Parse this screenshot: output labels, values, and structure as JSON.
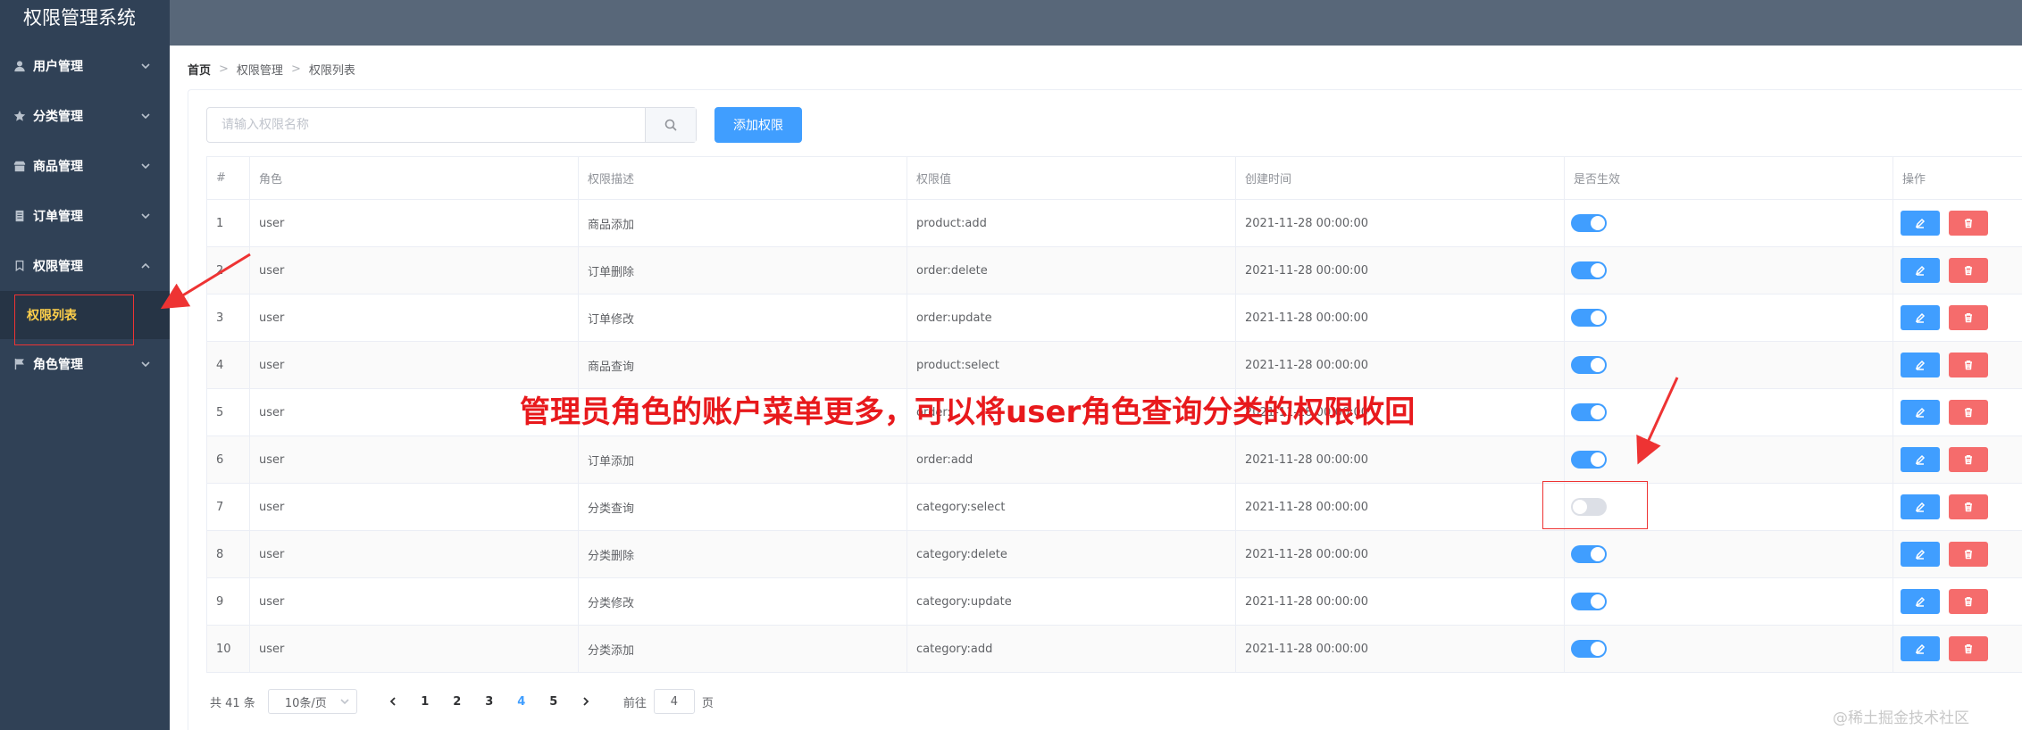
{
  "app": {
    "title": "权限管理系统"
  },
  "sidebar": {
    "items": [
      {
        "label": "用户管理",
        "icon": "user-icon"
      },
      {
        "label": "分类管理",
        "icon": "star-icon"
      },
      {
        "label": "商品管理",
        "icon": "shop-icon"
      },
      {
        "label": "订单管理",
        "icon": "order-icon"
      },
      {
        "label": "权限管理",
        "icon": "bookmark-icon",
        "expanded": true,
        "children": [
          {
            "label": "权限列表",
            "active": true
          }
        ]
      },
      {
        "label": "角色管理",
        "icon": "flag-icon"
      }
    ]
  },
  "breadcrumb": [
    "首页",
    "权限管理",
    "权限列表"
  ],
  "toolbar": {
    "search_placeholder": "请输入权限名称",
    "search_value": "",
    "add_label": "添加权限"
  },
  "table": {
    "columns": [
      "#",
      "角色",
      "权限描述",
      "权限值",
      "创建时间",
      "是否生效",
      "操作"
    ],
    "rows": [
      {
        "index": "1",
        "role": "user",
        "desc": "商品添加",
        "value": "product:add",
        "created": "2021-11-28 00:00:00",
        "enabled": true
      },
      {
        "index": "2",
        "role": "user",
        "desc": "订单删除",
        "value": "order:delete",
        "created": "2021-11-28 00:00:00",
        "enabled": true
      },
      {
        "index": "3",
        "role": "user",
        "desc": "订单修改",
        "value": "order:update",
        "created": "2021-11-28 00:00:00",
        "enabled": true
      },
      {
        "index": "4",
        "role": "user",
        "desc": "商品查询",
        "value": "product:select",
        "created": "2021-11-28 00:00:00",
        "enabled": true
      },
      {
        "index": "5",
        "role": "user",
        "desc": "",
        "value": "order:",
        "created": "2021-11-28 00:00:00",
        "enabled": true
      },
      {
        "index": "6",
        "role": "user",
        "desc": "订单添加",
        "value": "order:add",
        "created": "2021-11-28 00:00:00",
        "enabled": true
      },
      {
        "index": "7",
        "role": "user",
        "desc": "分类查询",
        "value": "category:select",
        "created": "2021-11-28 00:00:00",
        "enabled": false
      },
      {
        "index": "8",
        "role": "user",
        "desc": "分类删除",
        "value": "category:delete",
        "created": "2021-11-28 00:00:00",
        "enabled": true
      },
      {
        "index": "9",
        "role": "user",
        "desc": "分类修改",
        "value": "category:update",
        "created": "2021-11-28 00:00:00",
        "enabled": true
      },
      {
        "index": "10",
        "role": "user",
        "desc": "分类添加",
        "value": "category:add",
        "created": "2021-11-28 00:00:00",
        "enabled": true
      }
    ]
  },
  "pagination": {
    "total_label": "共 41 条",
    "page_size_label": "10条/页",
    "pages": [
      "1",
      "2",
      "3",
      "4",
      "5"
    ],
    "current_page": "4",
    "goto_prefix": "前往",
    "goto_value": "4",
    "goto_suffix": "页"
  },
  "annotation": {
    "text": "管理员角色的账户菜单更多，可以将user角色查询分类的权限收回",
    "color": "#e8191c"
  },
  "watermark": "@稀土掘金技术社区",
  "colors": {
    "sidebar": "#304156",
    "header": "#586779",
    "primary": "#409eff",
    "danger": "#f56c6c",
    "menu_active": "#ffd04b"
  }
}
